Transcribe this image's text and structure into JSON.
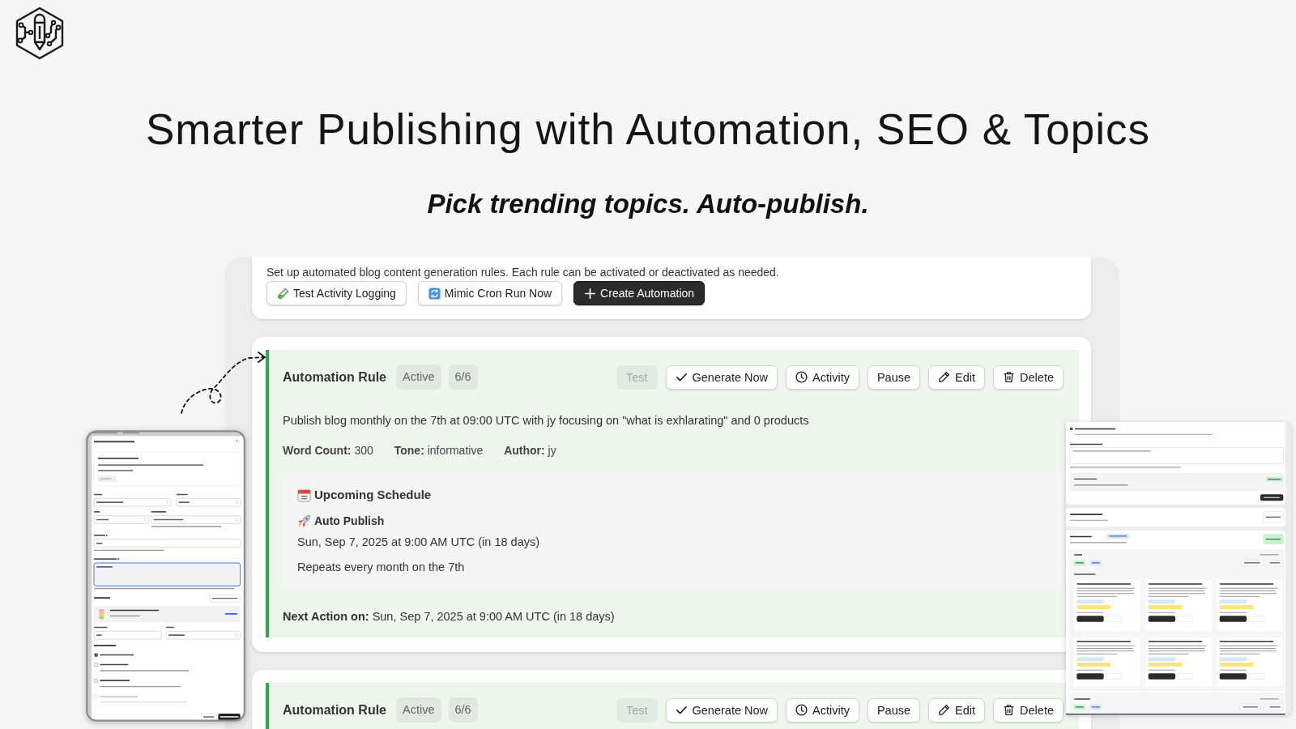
{
  "headline": "Smarter Publishing with Automation, SEO & Topics",
  "subheadline": "Pick trending topics. Auto-publish.",
  "automations": {
    "intro": "Set up automated blog content generation rules. Each rule can be activated or deactivated as needed.",
    "toolbar": [
      {
        "label": "Test Activity Logging",
        "kind": "test",
        "primary": false
      },
      {
        "label": "Mimic Cron Run Now",
        "kind": "cron",
        "primary": false
      },
      {
        "label": "Create Automation",
        "kind": "create",
        "primary": true
      }
    ],
    "rules": [
      {
        "title": "Automation Rule",
        "badges": [
          "Active",
          "6/6"
        ],
        "actions": [
          {
            "label": "Test",
            "kind": "test",
            "disabled": true
          },
          {
            "label": "Generate Now",
            "kind": "generate",
            "disabled": false
          },
          {
            "label": "Activity",
            "kind": "activity",
            "disabled": false
          },
          {
            "label": "Pause",
            "kind": "pause",
            "disabled": false
          },
          {
            "label": "Edit",
            "kind": "edit",
            "disabled": false
          },
          {
            "label": "Delete",
            "kind": "delete",
            "disabled": false
          }
        ],
        "description": "Publish blog monthly on the 7th at 09:00 UTC with jy focusing on \"what is exhlarating\" and 0 products",
        "details": [
          "**Word Count:** 300",
          "**Tone:** informative",
          "**Author:** jy"
        ],
        "schedule": {
          "title": "Upcoming Schedule",
          "event_title": "Auto Publish",
          "date": "Sun, Sep 7, 2025 at 9:00 AM UTC (in 18 days)",
          "repeat": "Repeats every month on the 7th"
        },
        "next_action": "**Next Action on:** Sun, Sep 7, 2025 at 9:00 AM UTC (in 18 days)"
      },
      {
        "title": "Automation Rule",
        "badges": [
          "Active",
          "6/6"
        ],
        "actions": [
          {
            "label": "Test",
            "kind": "test",
            "disabled": true
          },
          {
            "label": "Generate Now",
            "kind": "generate",
            "disabled": false
          },
          {
            "label": "Activity",
            "kind": "activity",
            "disabled": false
          },
          {
            "label": "Pause",
            "kind": "pause",
            "disabled": false
          },
          {
            "label": "Edit",
            "kind": "edit",
            "disabled": false
          },
          {
            "label": "Delete",
            "kind": "delete",
            "disabled": false
          }
        ]
      }
    ]
  }
}
